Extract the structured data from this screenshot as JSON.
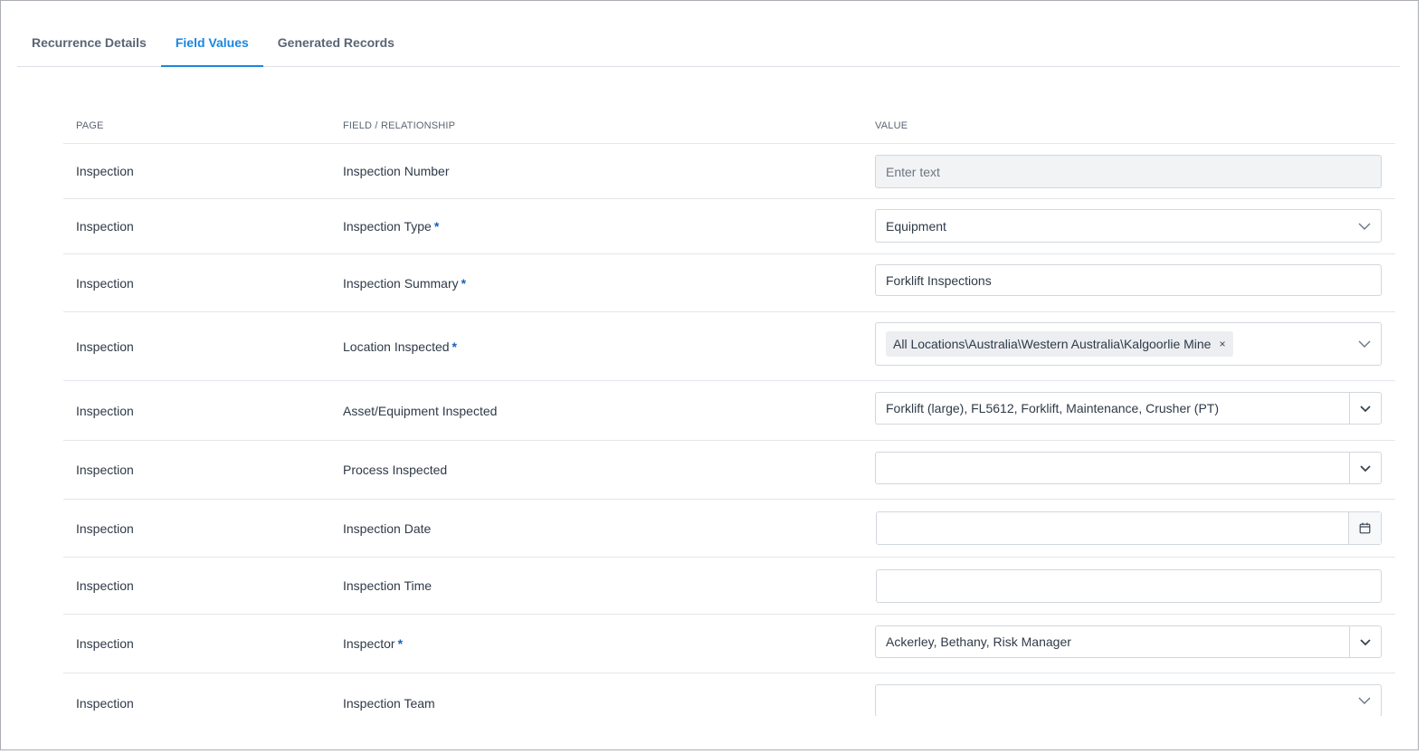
{
  "tabs": [
    {
      "label": "Recurrence Details",
      "active": false
    },
    {
      "label": "Field Values",
      "active": true
    },
    {
      "label": "Generated Records",
      "active": false
    }
  ],
  "table": {
    "headers": {
      "page": "PAGE",
      "field": "FIELD / RELATIONSHIP",
      "value": "VALUE"
    },
    "rows": [
      {
        "page": "Inspection",
        "field": "Inspection Number",
        "required": "",
        "value": "",
        "placeholder": "Enter text"
      },
      {
        "page": "Inspection",
        "field": "Inspection Type",
        "required": "*",
        "value": "Equipment"
      },
      {
        "page": "Inspection",
        "field": "Inspection Summary",
        "required": "*",
        "value": "Forklift Inspections"
      },
      {
        "page": "Inspection",
        "field": "Location Inspected",
        "required": "*",
        "tag": "All Locations\\Australia\\Western Australia\\Kalgoorlie Mine",
        "tag_remove": "×"
      },
      {
        "page": "Inspection",
        "field": "Asset/Equipment Inspected",
        "required": "",
        "value": "Forklift (large), FL5612, Forklift, Maintenance, Crusher (PT)"
      },
      {
        "page": "Inspection",
        "field": "Process Inspected",
        "required": "",
        "value": ""
      },
      {
        "page": "Inspection",
        "field": "Inspection Date",
        "required": "",
        "value": ""
      },
      {
        "page": "Inspection",
        "field": "Inspection Time",
        "required": "",
        "value": ""
      },
      {
        "page": "Inspection",
        "field": "Inspector",
        "required": "*",
        "value": "Ackerley, Bethany, Risk Manager"
      },
      {
        "page": "Inspection",
        "field": "Inspection Team",
        "required": "",
        "value": ""
      }
    ]
  },
  "icons": {
    "dropdown": "chevron-down-icon",
    "date": "calendar-icon",
    "remove": "close-icon"
  },
  "colors": {
    "accent": "#1a86e0",
    "required": "#1a62b8",
    "text": "#2f3a48",
    "disabled_bg": "#f1f3f5"
  }
}
